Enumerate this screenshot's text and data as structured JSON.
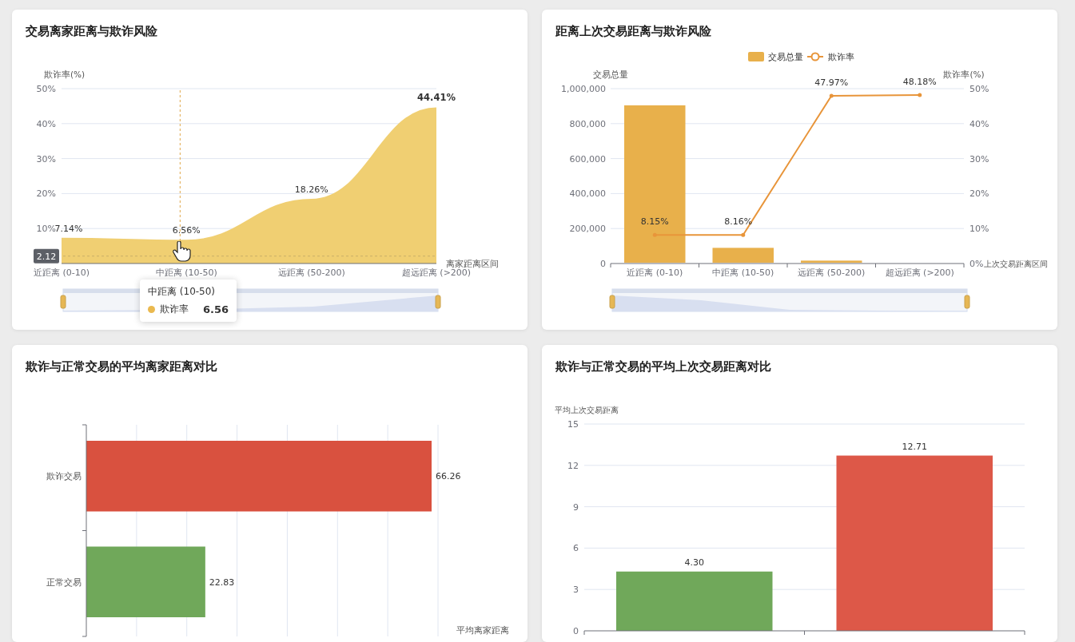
{
  "panels": [
    {
      "title": "交易离家距离与欺诈风险",
      "chart_data": {
        "type": "area",
        "ylabel": "欺诈率(%)",
        "xlabel": "离家距离区间",
        "categories": [
          "近距离 (0-10)",
          "中距离 (10-50)",
          "远距离 (50-200)",
          "超远距离 (>200)"
        ],
        "series": [
          {
            "color": "#f0cf72",
            "values": [
              7.14,
              6.56,
              18.26,
              44.41
            ]
          }
        ],
        "ylim": [
          0,
          50
        ],
        "yticks": [
          {
            "value": 10,
            "label": "10%"
          },
          {
            "value": 20,
            "label": "20%"
          },
          {
            "value": 30,
            "label": "30%"
          },
          {
            "value": 40,
            "label": "40%"
          },
          {
            "value": 50,
            "label": "50%"
          }
        ],
        "grid": true,
        "value_labels": [
          "7.14%",
          "6.56%",
          "18.26%",
          "44.41%"
        ]
      },
      "axis_pointer": {
        "label": "2.12"
      },
      "tooltip": {
        "title": "中距离 (10-50)",
        "series_name": "欺诈率",
        "value": "6.56",
        "color": "#eab94f"
      }
    },
    {
      "title": "距离上次交易距离与欺诈风险",
      "chart_data": {
        "type": "bar",
        "ylabel": "交易总量",
        "xlabel": "上次交易距离区间",
        "categories": [
          "近距离 (0-10)",
          "中距离 (10-50)",
          "远距离 (50-200)",
          "超远距离 (>200)"
        ],
        "series": [
          {
            "name": "交易总量",
            "color": "#e8b04b",
            "values": [
              900000,
              85000,
              12000,
              null
            ]
          }
        ],
        "ylim": [
          0,
          1000000
        ],
        "yticks": [
          {
            "value": 0,
            "label": "0"
          },
          {
            "value": 200000,
            "label": "200,000"
          },
          {
            "value": 400000,
            "label": "400,000"
          },
          {
            "value": 600000,
            "label": "600,000"
          },
          {
            "value": 800000,
            "label": "800,000"
          },
          {
            "value": 1000000,
            "label": "1,000,000"
          }
        ],
        "grid": true,
        "legend": "top"
      },
      "overlay_chart": {
        "chart_data": {
          "type": "line",
          "ylabel": "欺诈率(%)",
          "series": [
            {
              "name": "欺诈率",
              "color": "#e8953a",
              "values": [
                8.15,
                8.16,
                47.97,
                48.18
              ]
            }
          ],
          "ylim": [
            0,
            50
          ],
          "yticks": [
            {
              "value": 0,
              "label": "0%"
            },
            {
              "value": 10,
              "label": "10%"
            },
            {
              "value": 20,
              "label": "20%"
            },
            {
              "value": 30,
              "label": "30%"
            },
            {
              "value": 40,
              "label": "40%"
            },
            {
              "value": 50,
              "label": "50%"
            }
          ],
          "value_labels": [
            "8.15%",
            "8.16%",
            "47.97%",
            "48.18%"
          ]
        }
      }
    },
    {
      "title": "欺诈与正常交易的平均离家距离对比",
      "chart_data": {
        "type": "bar",
        "orientation": "horizontal",
        "xlabel": "平均离家距离",
        "categories": [
          "欺诈交易",
          "正常交易"
        ],
        "series": [
          {
            "values": [
              66.26,
              22.83
            ],
            "colors": [
              "#d9513f",
              "#70a85a"
            ]
          }
        ],
        "grid": true,
        "data_labels": true
      }
    },
    {
      "title": "欺诈与正常交易的平均上次交易距离对比",
      "chart_data": {
        "type": "bar",
        "orientation": "vertical",
        "ylabel": "平均上次交易距离",
        "series": [
          {
            "values": [
              4.3,
              12.71
            ],
            "colors": [
              "#70a85a",
              "#dd5848"
            ]
          }
        ],
        "ylim": [
          0,
          15
        ],
        "yticks": [
          0,
          3,
          6,
          9,
          12,
          15
        ],
        "grid": true,
        "value_labels": [
          "4.30",
          "12.71"
        ]
      }
    }
  ]
}
